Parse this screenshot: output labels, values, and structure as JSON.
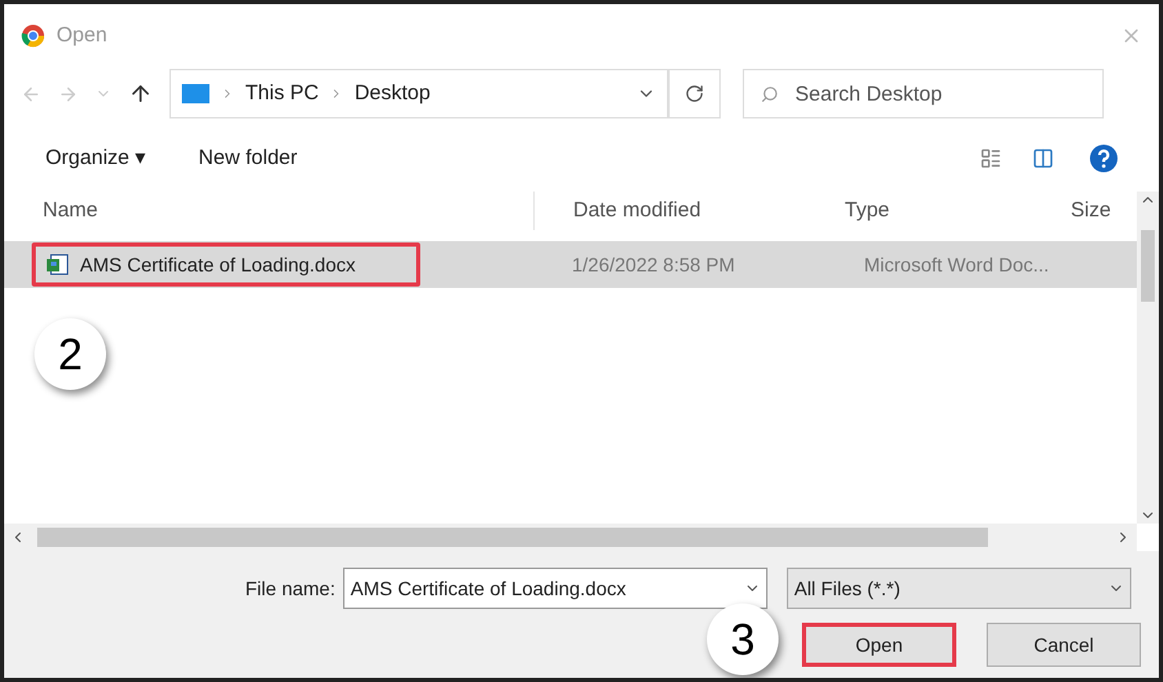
{
  "window": {
    "title": "Open"
  },
  "address_bar": {
    "path": [
      "This PC",
      "Desktop"
    ]
  },
  "search": {
    "placeholder": "Search Desktop"
  },
  "toolbar": {
    "organize": "Organize ▾",
    "new_folder": "New folder"
  },
  "table": {
    "columns": [
      "Name",
      "Date modified",
      "Type",
      "Size"
    ],
    "rows": [
      {
        "name": "AMS Certificate of Loading.docx",
        "date": "1/26/2022 8:58 PM",
        "type": "Microsoft Word Doc...",
        "selected": true,
        "highlighted": true
      }
    ]
  },
  "callouts": [
    {
      "label": "2"
    },
    {
      "label": "3"
    }
  ],
  "file_name": {
    "label": "File name:",
    "value": "AMS Certificate of Loading.docx"
  },
  "filter": {
    "value": "All Files (*.*)"
  },
  "buttons": [
    {
      "label": "Open",
      "highlighted": true
    },
    {
      "label": "Cancel",
      "highlighted": false
    }
  ]
}
